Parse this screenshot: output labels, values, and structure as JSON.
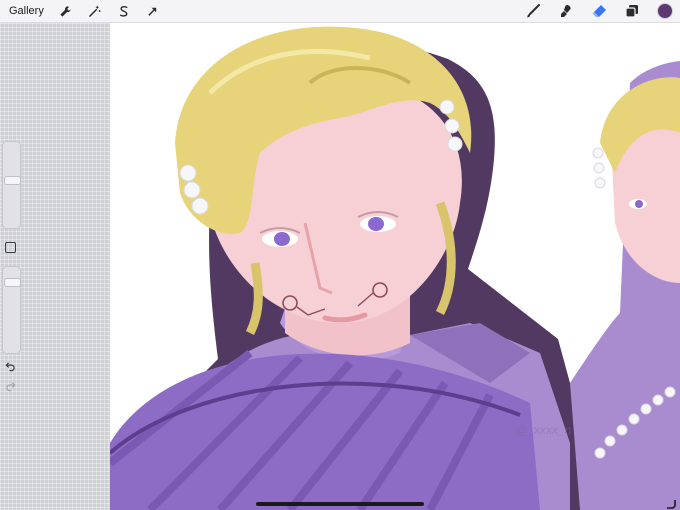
{
  "toolbar": {
    "gallery_label": "Gallery",
    "left_tools": [
      "wrench-icon",
      "magic-wand-icon",
      "selection-s-icon",
      "transform-arrow-icon"
    ],
    "right_tools": [
      "brush-icon",
      "smudge-icon",
      "eraser-icon",
      "layers-icon"
    ],
    "active_tool": "eraser-icon",
    "current_color": "#5b3a74"
  },
  "sidebar": {
    "brush_size_level": 0.55,
    "opacity_level": 0.85,
    "undo_icon": "undo-icon",
    "redo_icon": "redo-icon"
  },
  "canvas": {
    "watermark": "@_xxxx_n"
  },
  "colors": {
    "toolbar_bg": "#f4f4f6",
    "canvas_bg": "#ffffff",
    "accent_blue": "#3478f6",
    "hair": "#e6d37a",
    "skin": "#f7d0d6",
    "clothing": "#a98bd0",
    "fan": "#8c6cc4"
  }
}
